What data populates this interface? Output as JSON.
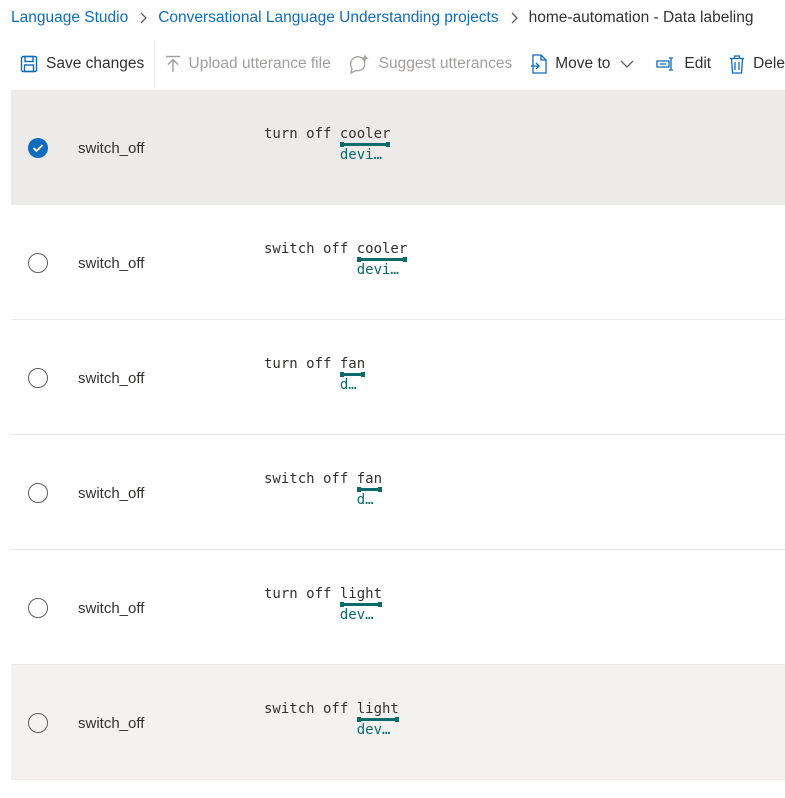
{
  "breadcrumb": {
    "items": [
      "Language Studio",
      "Conversational Language Understanding projects",
      "home-automation - Data labeling"
    ]
  },
  "toolbar": {
    "save": "Save changes",
    "upload": "Upload utterance file",
    "suggest": "Suggest utterances",
    "move": "Move to",
    "edit": "Edit",
    "delete": "Dele"
  },
  "rows": [
    {
      "intent": "switch_off",
      "prefix": "turn off ",
      "entity": "cooler",
      "entity_label": "devi…",
      "selected": true
    },
    {
      "intent": "switch_off",
      "prefix": "switch off ",
      "entity": "cooler",
      "entity_label": "devi…",
      "selected": false
    },
    {
      "intent": "switch_off",
      "prefix": "turn off ",
      "entity": "fan",
      "entity_label": "d…",
      "selected": false
    },
    {
      "intent": "switch_off",
      "prefix": "switch off ",
      "entity": "fan",
      "entity_label": "d…",
      "selected": false
    },
    {
      "intent": "switch_off",
      "prefix": "turn off ",
      "entity": "light",
      "entity_label": "dev…",
      "selected": false
    },
    {
      "intent": "switch_off",
      "prefix": "switch off ",
      "entity": "light",
      "entity_label": "dev…",
      "selected": false
    }
  ],
  "colors": {
    "accent": "#0f6cbd",
    "entity": "#0b6a6a",
    "selected_bg": "#edebe9"
  }
}
